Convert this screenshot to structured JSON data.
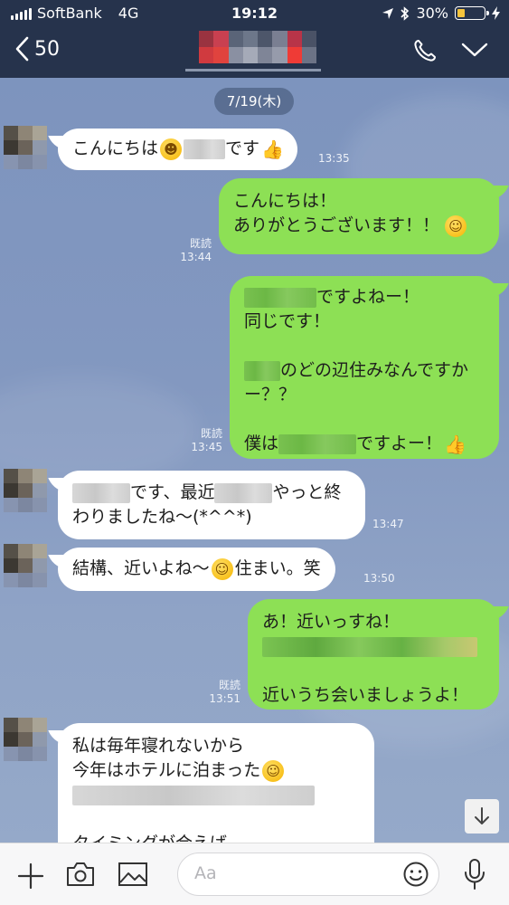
{
  "status_bar": {
    "carrier": "SoftBank",
    "network": "4G",
    "time": "19:12",
    "battery_percent": "30%",
    "battery_level": 0.3
  },
  "nav": {
    "back_count": "50"
  },
  "date_label": "7/19(木)",
  "messages": [
    {
      "side": "in",
      "line1_a": "こんにちは",
      "line1_b": "です",
      "time": "13:35"
    },
    {
      "side": "out",
      "line1": "こんにちは！",
      "line2": "ありがとうございます！！",
      "read": "既読",
      "time": "13:44"
    },
    {
      "side": "out",
      "line1": "ですよねー！",
      "line2": "同じです！",
      "line3": "のどの辺住みなんですか",
      "line4": "ー？？",
      "line5_a": "僕は",
      "line5_b": "ですよー！",
      "read": "既読",
      "time": "13:45"
    },
    {
      "side": "in",
      "line1_a": "です、最近",
      "line1_b": "やっと終",
      "line2": "わりましたね〜(*^^*)",
      "time": "13:47"
    },
    {
      "side": "in",
      "line1_a": "結構、近いよね〜",
      "line1_b": "住まい。笑",
      "time": "13:50"
    },
    {
      "side": "out",
      "line1": "あ！近いっすね！",
      "line3": "近いうち会いましょうよ！",
      "read": "既読",
      "time": "13:51"
    },
    {
      "side": "in",
      "line1": "私は毎年寝れないから",
      "line2": "今年はホテルに泊まった",
      "line4": "タイミングが合えば"
    }
  ],
  "input": {
    "placeholder": "Aa"
  },
  "icons": {
    "back": "chevron-left-icon",
    "call": "phone-icon",
    "menu": "chevron-down-icon",
    "add": "plus-icon",
    "camera": "camera-icon",
    "image": "image-icon",
    "emoji": "smiley-icon",
    "mic": "microphone-icon",
    "scroll": "arrow-down-icon"
  },
  "colors": {
    "header_bg": "#26334c",
    "chat_bg": "#7f96bf",
    "outgoing_bubble": "#8de055",
    "incoming_bubble": "#ffffff",
    "battery_fill": "#f5c43c"
  }
}
